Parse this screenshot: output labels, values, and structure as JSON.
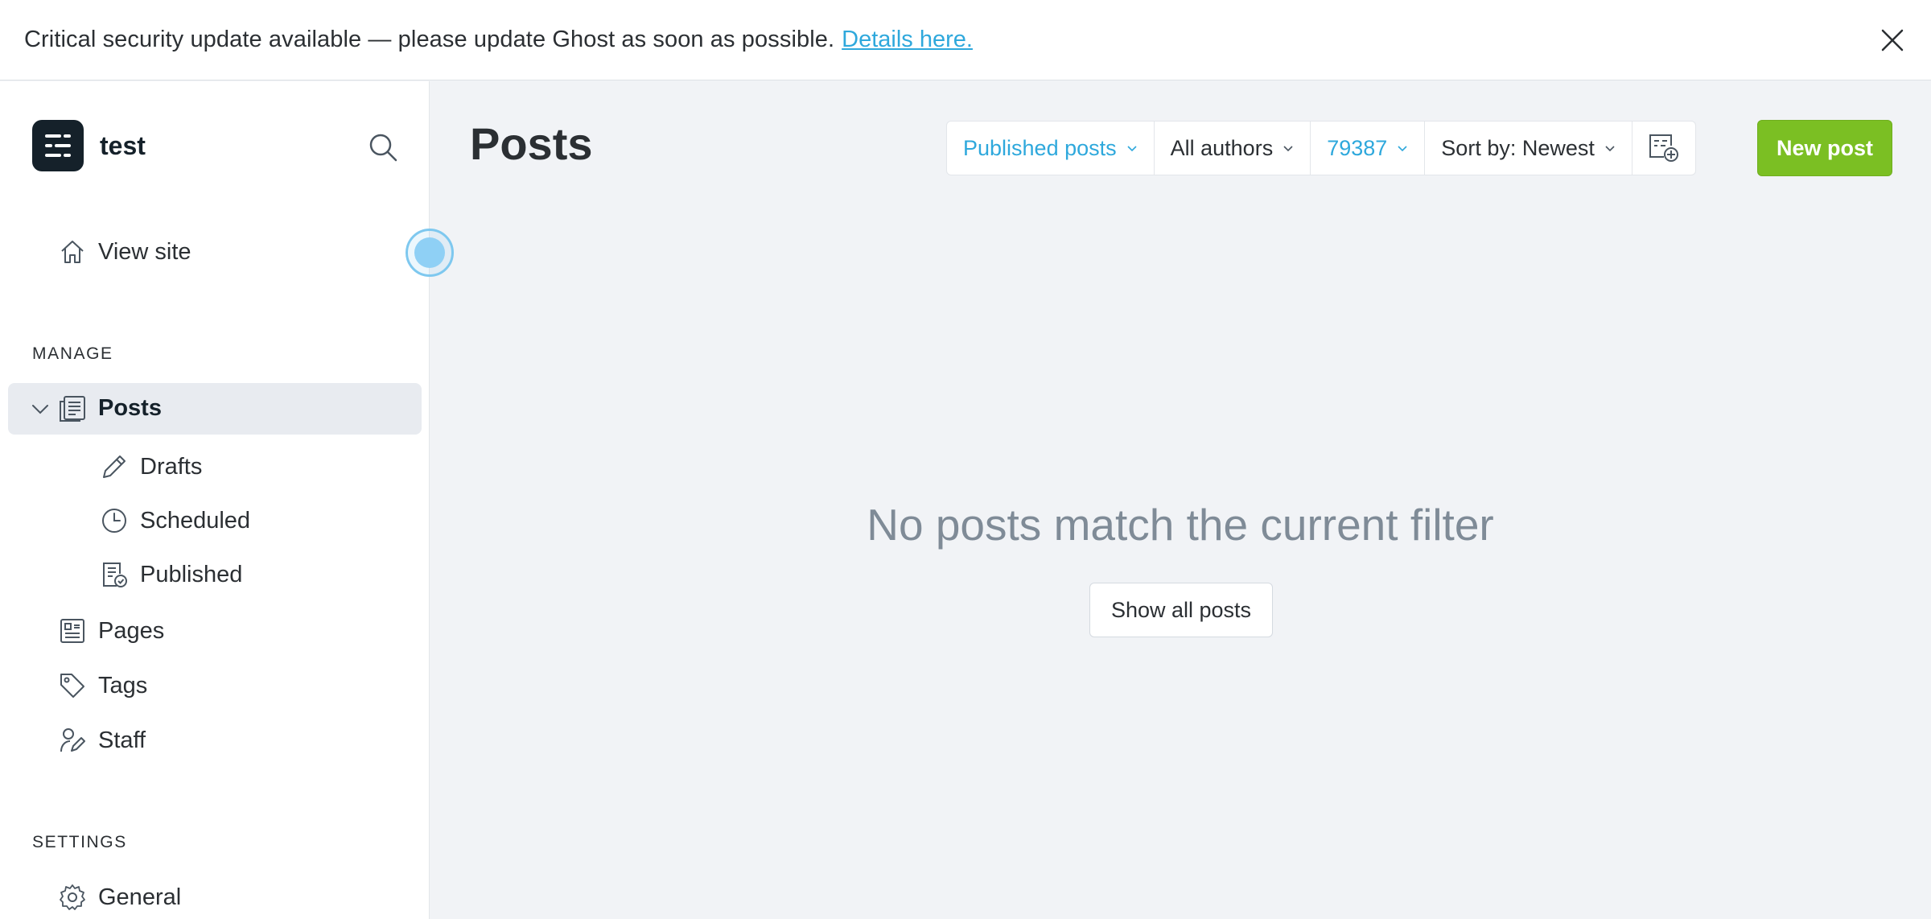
{
  "banner": {
    "message": "Critical security update available — please update Ghost as soon as possible.",
    "link_text": "Details here."
  },
  "sidebar": {
    "site_name": "test",
    "view_site": "View site",
    "manage_title": "MANAGE",
    "posts": "Posts",
    "sub_items": {
      "drafts": "Drafts",
      "scheduled": "Scheduled",
      "published": "Published"
    },
    "pages": "Pages",
    "tags": "Tags",
    "staff": "Staff",
    "settings_title": "SETTINGS",
    "general": "General"
  },
  "main": {
    "title": "Posts",
    "filters": {
      "type": "Published posts",
      "author": "All authors",
      "tag": "79387",
      "sort": "Sort by: Newest"
    },
    "new_post": "New post",
    "empty_message": "No posts match the current filter",
    "show_all": "Show all posts"
  },
  "colors": {
    "accent": "#2ea8dc",
    "primary_button": "#7bbf23",
    "active_nav_bg": "#e8ebf0",
    "background": "#f1f3f6"
  }
}
